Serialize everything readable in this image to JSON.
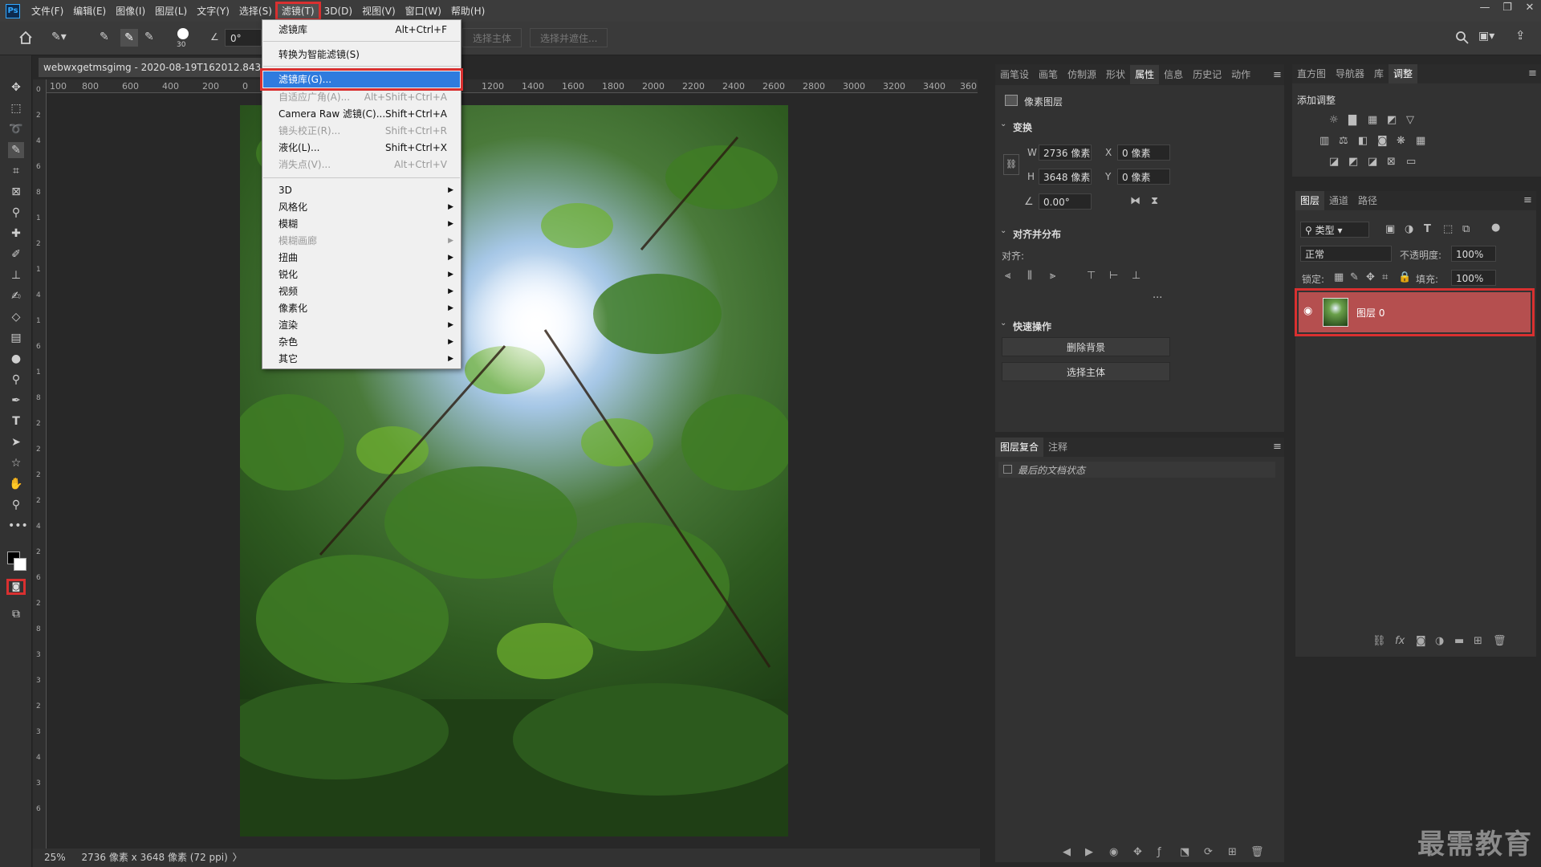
{
  "menubar": {
    "logo": "Ps",
    "items": [
      "文件(F)",
      "编辑(E)",
      "图像(I)",
      "图层(L)",
      "文字(Y)",
      "选择(S)",
      "滤镜(T)",
      "3D(D)",
      "视图(V)",
      "窗口(W)",
      "帮助(H)"
    ],
    "active_index": 6,
    "window_controls": [
      "—",
      "❐",
      "✕"
    ]
  },
  "options_bar": {
    "brush_size": "30",
    "angle_value": "0°",
    "select_subject": "选择主体",
    "select_and_mask": "选择并遮住..."
  },
  "document": {
    "tab_title": "webwxgetmsgimg - 2020-08-19T162012.843.jp",
    "ruler_top_labels": [
      "100",
      "800",
      "600",
      "400",
      "200",
      "0",
      "1200",
      "1400",
      "1600",
      "1800",
      "2000",
      "2200",
      "2400",
      "2600",
      "2800",
      "3000",
      "3200",
      "3400",
      "360"
    ],
    "ruler_left_labels": [
      "0",
      "2",
      "4",
      "6",
      "8",
      "1",
      "2",
      "1",
      "4",
      "1",
      "6",
      "1",
      "8",
      "2",
      "2",
      "2",
      "2",
      "4",
      "2",
      "6",
      "2",
      "8",
      "3",
      "3",
      "2",
      "3",
      "4",
      "3",
      "6"
    ]
  },
  "status_bar": {
    "zoom": "25%",
    "info": "2736 像素 x 3648 像素 (72 ppi)",
    "arrow": "〉"
  },
  "filter_menu": {
    "items": [
      {
        "label": "滤镜库",
        "shortcut": "Alt+Ctrl+F",
        "disabled": false
      },
      {
        "label": "转换为智能滤镜(S)",
        "shortcut": "",
        "disabled": false
      },
      {
        "label": "滤镜库(G)...",
        "shortcut": "",
        "disabled": false,
        "highlighted": true
      },
      {
        "label": "自适应广角(A)...",
        "shortcut": "Alt+Shift+Ctrl+A",
        "disabled": true
      },
      {
        "label": "Camera Raw 滤镜(C)...",
        "shortcut": "Shift+Ctrl+A",
        "disabled": false
      },
      {
        "label": "镜头校正(R)...",
        "shortcut": "Shift+Ctrl+R",
        "disabled": true
      },
      {
        "label": "液化(L)...",
        "shortcut": "Shift+Ctrl+X",
        "disabled": false
      },
      {
        "label": "消失点(V)...",
        "shortcut": "Alt+Ctrl+V",
        "disabled": true
      },
      {
        "label": "3D",
        "submenu": true,
        "disabled": false
      },
      {
        "label": "风格化",
        "submenu": true,
        "disabled": false
      },
      {
        "label": "模糊",
        "submenu": true,
        "disabled": false
      },
      {
        "label": "模糊画廊",
        "submenu": true,
        "disabled": true
      },
      {
        "label": "扭曲",
        "submenu": true,
        "disabled": false
      },
      {
        "label": "锐化",
        "submenu": true,
        "disabled": false
      },
      {
        "label": "视频",
        "submenu": true,
        "disabled": false
      },
      {
        "label": "像素化",
        "submenu": true,
        "disabled": false
      },
      {
        "label": "渲染",
        "submenu": true,
        "disabled": false
      },
      {
        "label": "杂色",
        "submenu": true,
        "disabled": false
      },
      {
        "label": "其它",
        "submenu": true,
        "disabled": false
      }
    ]
  },
  "properties_panel": {
    "tabs": [
      "画笔设",
      "画笔",
      "仿制源",
      "形状",
      "属性",
      "信息",
      "历史记",
      "动作"
    ],
    "active_tab": "属性",
    "layer_type": "像素图层",
    "transform_title": "变换",
    "w_label": "W",
    "w_value": "2736 像素",
    "h_label": "H",
    "h_value": "3648 像素",
    "x_label": "X",
    "x_value": "0 像素",
    "y_label": "Y",
    "y_value": "0 像素",
    "angle_value": "0.00°",
    "align_title": "对齐并分布",
    "align_label": "对齐:",
    "more": "...",
    "quick_title": "快速操作",
    "remove_bg": "删除背景",
    "select_subject": "选择主体"
  },
  "comps_panel": {
    "tabs": [
      "图层复合",
      "注释"
    ],
    "last_state": "最后的文档状态"
  },
  "adjust_panel": {
    "tabs": [
      "直方图",
      "导航器",
      "库",
      "调整"
    ],
    "active_tab": "调整",
    "title": "添加调整"
  },
  "layers_panel": {
    "tabs": [
      "图层",
      "通道",
      "路径"
    ],
    "active_tab": "图层",
    "kind_filter": "类型",
    "blend_mode": "正常",
    "opacity_label": "不透明度:",
    "opacity_value": "100%",
    "lock_label": "锁定:",
    "fill_label": "填充:",
    "fill_value": "100%",
    "layer_name": "图层 0"
  },
  "watermark": "最需教育",
  "colors": {
    "accent_red": "#d93030",
    "menu_highlight": "#2f7bde",
    "layer_selected": "#b54f4f"
  }
}
